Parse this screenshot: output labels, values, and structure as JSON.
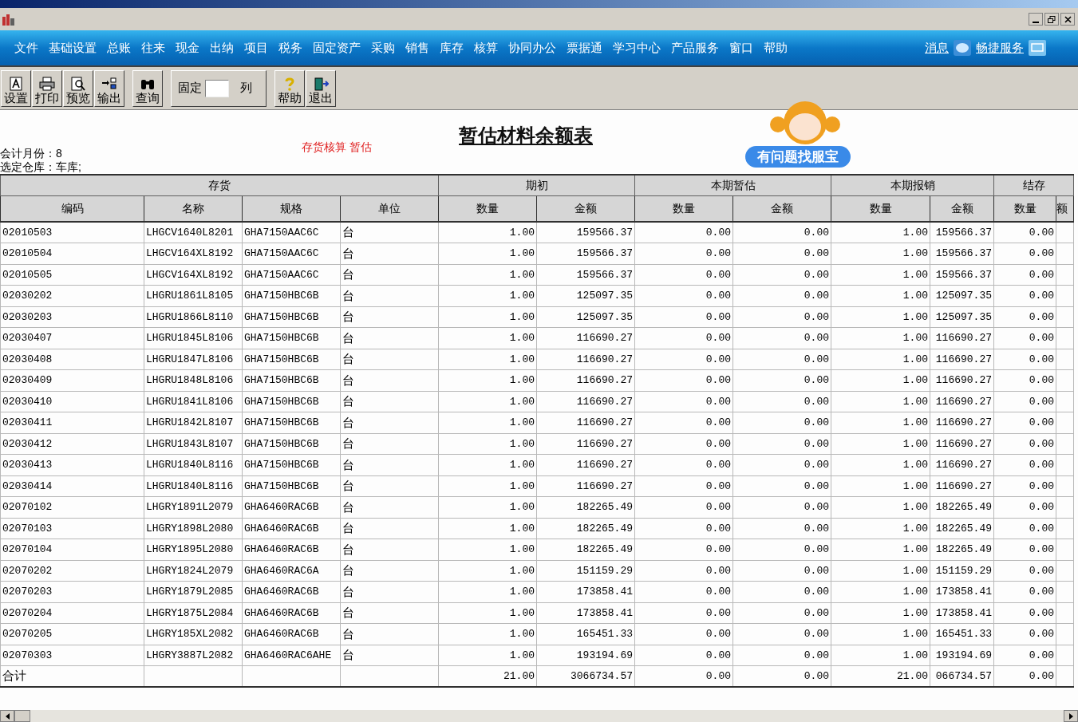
{
  "menu": [
    "文件",
    "基础设置",
    "总账",
    "往来",
    "现金",
    "出纳",
    "项目",
    "税务",
    "固定资产",
    "采购",
    "销售",
    "库存",
    "核算",
    "协同办公",
    "票据通",
    "学习中心",
    "产品服务",
    "窗口",
    "帮助"
  ],
  "menu_links": [
    "消息",
    "畅捷服务"
  ],
  "toolbar": [
    {
      "label": "设置",
      "kind": "font"
    },
    {
      "label": "打印",
      "kind": "print"
    },
    {
      "label": "预览",
      "kind": "preview"
    },
    {
      "label": "输出",
      "kind": "export"
    },
    {
      "label": "查询",
      "kind": "find"
    },
    {
      "kind": "freeze",
      "label": "固定",
      "suffix": "列"
    },
    {
      "label": "帮助",
      "kind": "help"
    },
    {
      "label": "退出",
      "kind": "exit"
    }
  ],
  "report": {
    "title": "暂估材料余额表",
    "subtitle": "存货核算 暂估",
    "help_badge": "有问题找服宝",
    "month": "会计月份：8",
    "warehouse": "选定仓库：车库;"
  },
  "table": {
    "groups": [
      "存货",
      "期初",
      "本期暂估",
      "本期报销",
      "结存"
    ],
    "columns": [
      "编码",
      "名称",
      "规格",
      "单位",
      "数量",
      "金额",
      "数量",
      "金额",
      "数量",
      "金额",
      "数量",
      "额"
    ],
    "rows": [
      [
        "02010503",
        "LHGCV1640L8201",
        "GHA7150AAC6C",
        "台",
        "1.00",
        "159566.37",
        "0.00",
        "0.00",
        "1.00",
        "159566.37",
        "0.00"
      ],
      [
        "02010504",
        "LHGCV164XL8192",
        "GHA7150AAC6C",
        "台",
        "1.00",
        "159566.37",
        "0.00",
        "0.00",
        "1.00",
        "159566.37",
        "0.00"
      ],
      [
        "02010505",
        "LHGCV164XL8192",
        "GHA7150AAC6C",
        "台",
        "1.00",
        "159566.37",
        "0.00",
        "0.00",
        "1.00",
        "159566.37",
        "0.00"
      ],
      [
        "02030202",
        "LHGRU1861L8105",
        "GHA7150HBC6B",
        "台",
        "1.00",
        "125097.35",
        "0.00",
        "0.00",
        "1.00",
        "125097.35",
        "0.00"
      ],
      [
        "02030203",
        "LHGRU1866L8110",
        "GHA7150HBC6B",
        "台",
        "1.00",
        "125097.35",
        "0.00",
        "0.00",
        "1.00",
        "125097.35",
        "0.00"
      ],
      [
        "02030407",
        "LHGRU1845L8106",
        "GHA7150HBC6B",
        "台",
        "1.00",
        "116690.27",
        "0.00",
        "0.00",
        "1.00",
        "116690.27",
        "0.00"
      ],
      [
        "02030408",
        "LHGRU1847L8106",
        "GHA7150HBC6B",
        "台",
        "1.00",
        "116690.27",
        "0.00",
        "0.00",
        "1.00",
        "116690.27",
        "0.00"
      ],
      [
        "02030409",
        "LHGRU1848L8106",
        "GHA7150HBC6B",
        "台",
        "1.00",
        "116690.27",
        "0.00",
        "0.00",
        "1.00",
        "116690.27",
        "0.00"
      ],
      [
        "02030410",
        "LHGRU1841L8106",
        "GHA7150HBC6B",
        "台",
        "1.00",
        "116690.27",
        "0.00",
        "0.00",
        "1.00",
        "116690.27",
        "0.00"
      ],
      [
        "02030411",
        "LHGRU1842L8107",
        "GHA7150HBC6B",
        "台",
        "1.00",
        "116690.27",
        "0.00",
        "0.00",
        "1.00",
        "116690.27",
        "0.00"
      ],
      [
        "02030412",
        "LHGRU1843L8107",
        "GHA7150HBC6B",
        "台",
        "1.00",
        "116690.27",
        "0.00",
        "0.00",
        "1.00",
        "116690.27",
        "0.00"
      ],
      [
        "02030413",
        "LHGRU1840L8116",
        "GHA7150HBC6B",
        "台",
        "1.00",
        "116690.27",
        "0.00",
        "0.00",
        "1.00",
        "116690.27",
        "0.00"
      ],
      [
        "02030414",
        "LHGRU1840L8116",
        "GHA7150HBC6B",
        "台",
        "1.00",
        "116690.27",
        "0.00",
        "0.00",
        "1.00",
        "116690.27",
        "0.00"
      ],
      [
        "02070102",
        "LHGRY1891L2079",
        "GHA6460RAC6B",
        "台",
        "1.00",
        "182265.49",
        "0.00",
        "0.00",
        "1.00",
        "182265.49",
        "0.00"
      ],
      [
        "02070103",
        "LHGRY1898L2080",
        "GHA6460RAC6B",
        "台",
        "1.00",
        "182265.49",
        "0.00",
        "0.00",
        "1.00",
        "182265.49",
        "0.00"
      ],
      [
        "02070104",
        "LHGRY1895L2080",
        "GHA6460RAC6B",
        "台",
        "1.00",
        "182265.49",
        "0.00",
        "0.00",
        "1.00",
        "182265.49",
        "0.00"
      ],
      [
        "02070202",
        "LHGRY1824L2079",
        "GHA6460RAC6A",
        "台",
        "1.00",
        "151159.29",
        "0.00",
        "0.00",
        "1.00",
        "151159.29",
        "0.00"
      ],
      [
        "02070203",
        "LHGRY1879L2085",
        "GHA6460RAC6B",
        "台",
        "1.00",
        "173858.41",
        "0.00",
        "0.00",
        "1.00",
        "173858.41",
        "0.00"
      ],
      [
        "02070204",
        "LHGRY1875L2084",
        "GHA6460RAC6B",
        "台",
        "1.00",
        "173858.41",
        "0.00",
        "0.00",
        "1.00",
        "173858.41",
        "0.00"
      ],
      [
        "02070205",
        "LHGRY185XL2082",
        "GHA6460RAC6B",
        "台",
        "1.00",
        "165451.33",
        "0.00",
        "0.00",
        "1.00",
        "165451.33",
        "0.00"
      ],
      [
        "02070303",
        "LHGRY3887L2082",
        "GHA6460RAC6AHE",
        "台",
        "1.00",
        "193194.69",
        "0.00",
        "0.00",
        "1.00",
        "193194.69",
        "0.00"
      ]
    ],
    "total": {
      "label": "合计",
      "values": [
        "21.00",
        "3066734.57",
        "0.00",
        "0.00",
        "21.00",
        "066734.57",
        "0.00"
      ]
    }
  }
}
